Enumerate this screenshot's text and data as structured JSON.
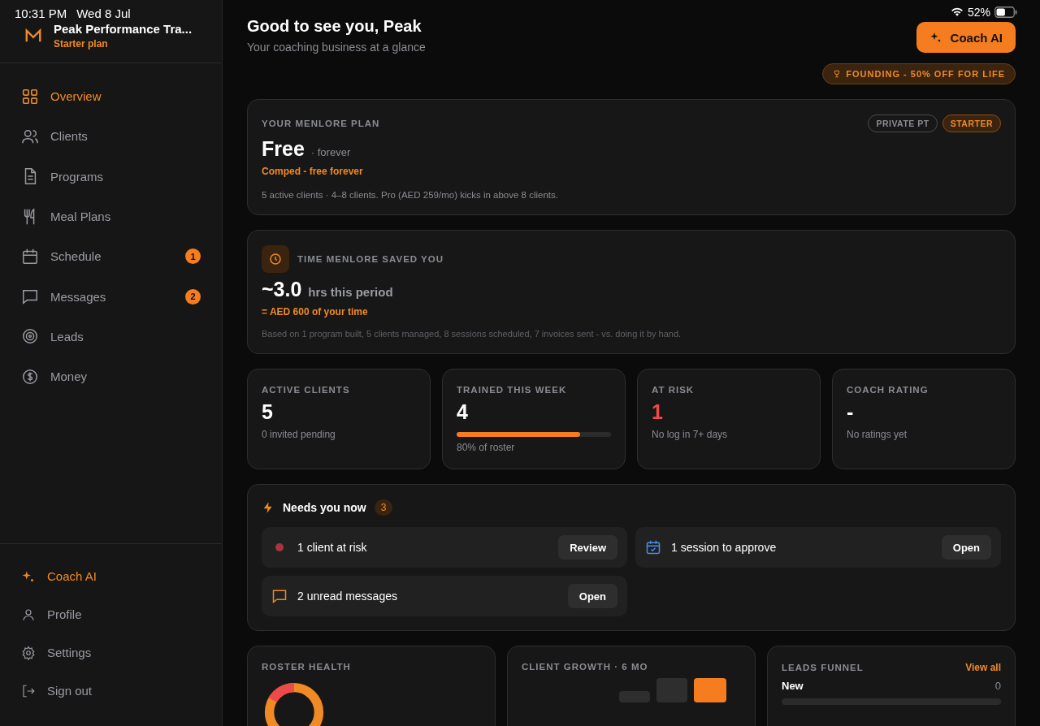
{
  "status_bar": {
    "time": "10:31 PM",
    "date": "Wed 8 Jul",
    "battery": "52%"
  },
  "brand": {
    "name": "Peak Performance Tra...",
    "plan": "Starter plan"
  },
  "sidebar": {
    "items": [
      {
        "label": "Overview",
        "selected": true
      },
      {
        "label": "Clients",
        "selected": false
      },
      {
        "label": "Programs",
        "selected": false
      },
      {
        "label": "Meal Plans",
        "selected": false
      },
      {
        "label": "Schedule",
        "selected": false,
        "badge": "1"
      },
      {
        "label": "Messages",
        "selected": false,
        "badge": "2"
      },
      {
        "label": "Leads",
        "selected": false
      },
      {
        "label": "Money",
        "selected": false
      }
    ],
    "footer_items": [
      {
        "label": "Coach AI",
        "accent": true
      },
      {
        "label": "Profile",
        "accent": false
      },
      {
        "label": "Settings",
        "accent": false
      },
      {
        "label": "Sign out",
        "accent": false
      }
    ]
  },
  "header": {
    "title": "Good to see you, Peak",
    "subtitle": "Your coaching business at a glance",
    "button": "Coach AI",
    "promo": "FOUNDING - 50% OFF FOR LIFE"
  },
  "plan_card": {
    "heading": "YOUR MENLORE PLAN",
    "tags": [
      {
        "label": "PRIVATE PT",
        "accent": false
      },
      {
        "label": "STARTER",
        "accent": true
      }
    ],
    "price": "Free",
    "period": "· forever",
    "note": "Comped - free forever",
    "detail": "5 active clients · 4–8 clients. Pro (AED 259/mo) kicks in above 8 clients."
  },
  "time_card": {
    "heading": "TIME MENLORE SAVED YOU",
    "value": "~3.0",
    "unit": "hrs this period",
    "worth": "= AED 600 of your time",
    "detail": "Based on 1 program built, 5 clients managed, 8 sessions scheduled, 7 invoices sent - vs. doing it by hand."
  },
  "stats": [
    {
      "label": "ACTIVE CLIENTS",
      "value": "5",
      "note": "0 invited pending",
      "alert": false
    },
    {
      "label": "TRAINED THIS WEEK",
      "value": "4",
      "note": "80% of roster",
      "alert": false,
      "level": 0.8
    },
    {
      "label": "AT RISK",
      "value": "1",
      "note": "No log in 7+ days",
      "alert": true
    },
    {
      "label": "COACH RATING",
      "value": "-",
      "note": "No ratings yet",
      "alert": false
    }
  ],
  "needs": {
    "title": "Needs you now",
    "count": "3",
    "items": [
      {
        "kind": "risk",
        "text": "1 client at risk",
        "action": "Review"
      },
      {
        "kind": "calendar",
        "text": "1 session to approve",
        "action": "Open"
      },
      {
        "kind": "message",
        "text": "2 unread messages",
        "action": "Open"
      }
    ]
  },
  "panels": {
    "roster": {
      "heading": "ROSTER HEALTH"
    },
    "growth": {
      "heading": "CLIENT GROWTH · 6 MO"
    },
    "leads": {
      "heading": "LEADS FUNNEL",
      "link": "View all",
      "rows": [
        {
          "label": "New",
          "count": "0"
        }
      ]
    }
  }
}
